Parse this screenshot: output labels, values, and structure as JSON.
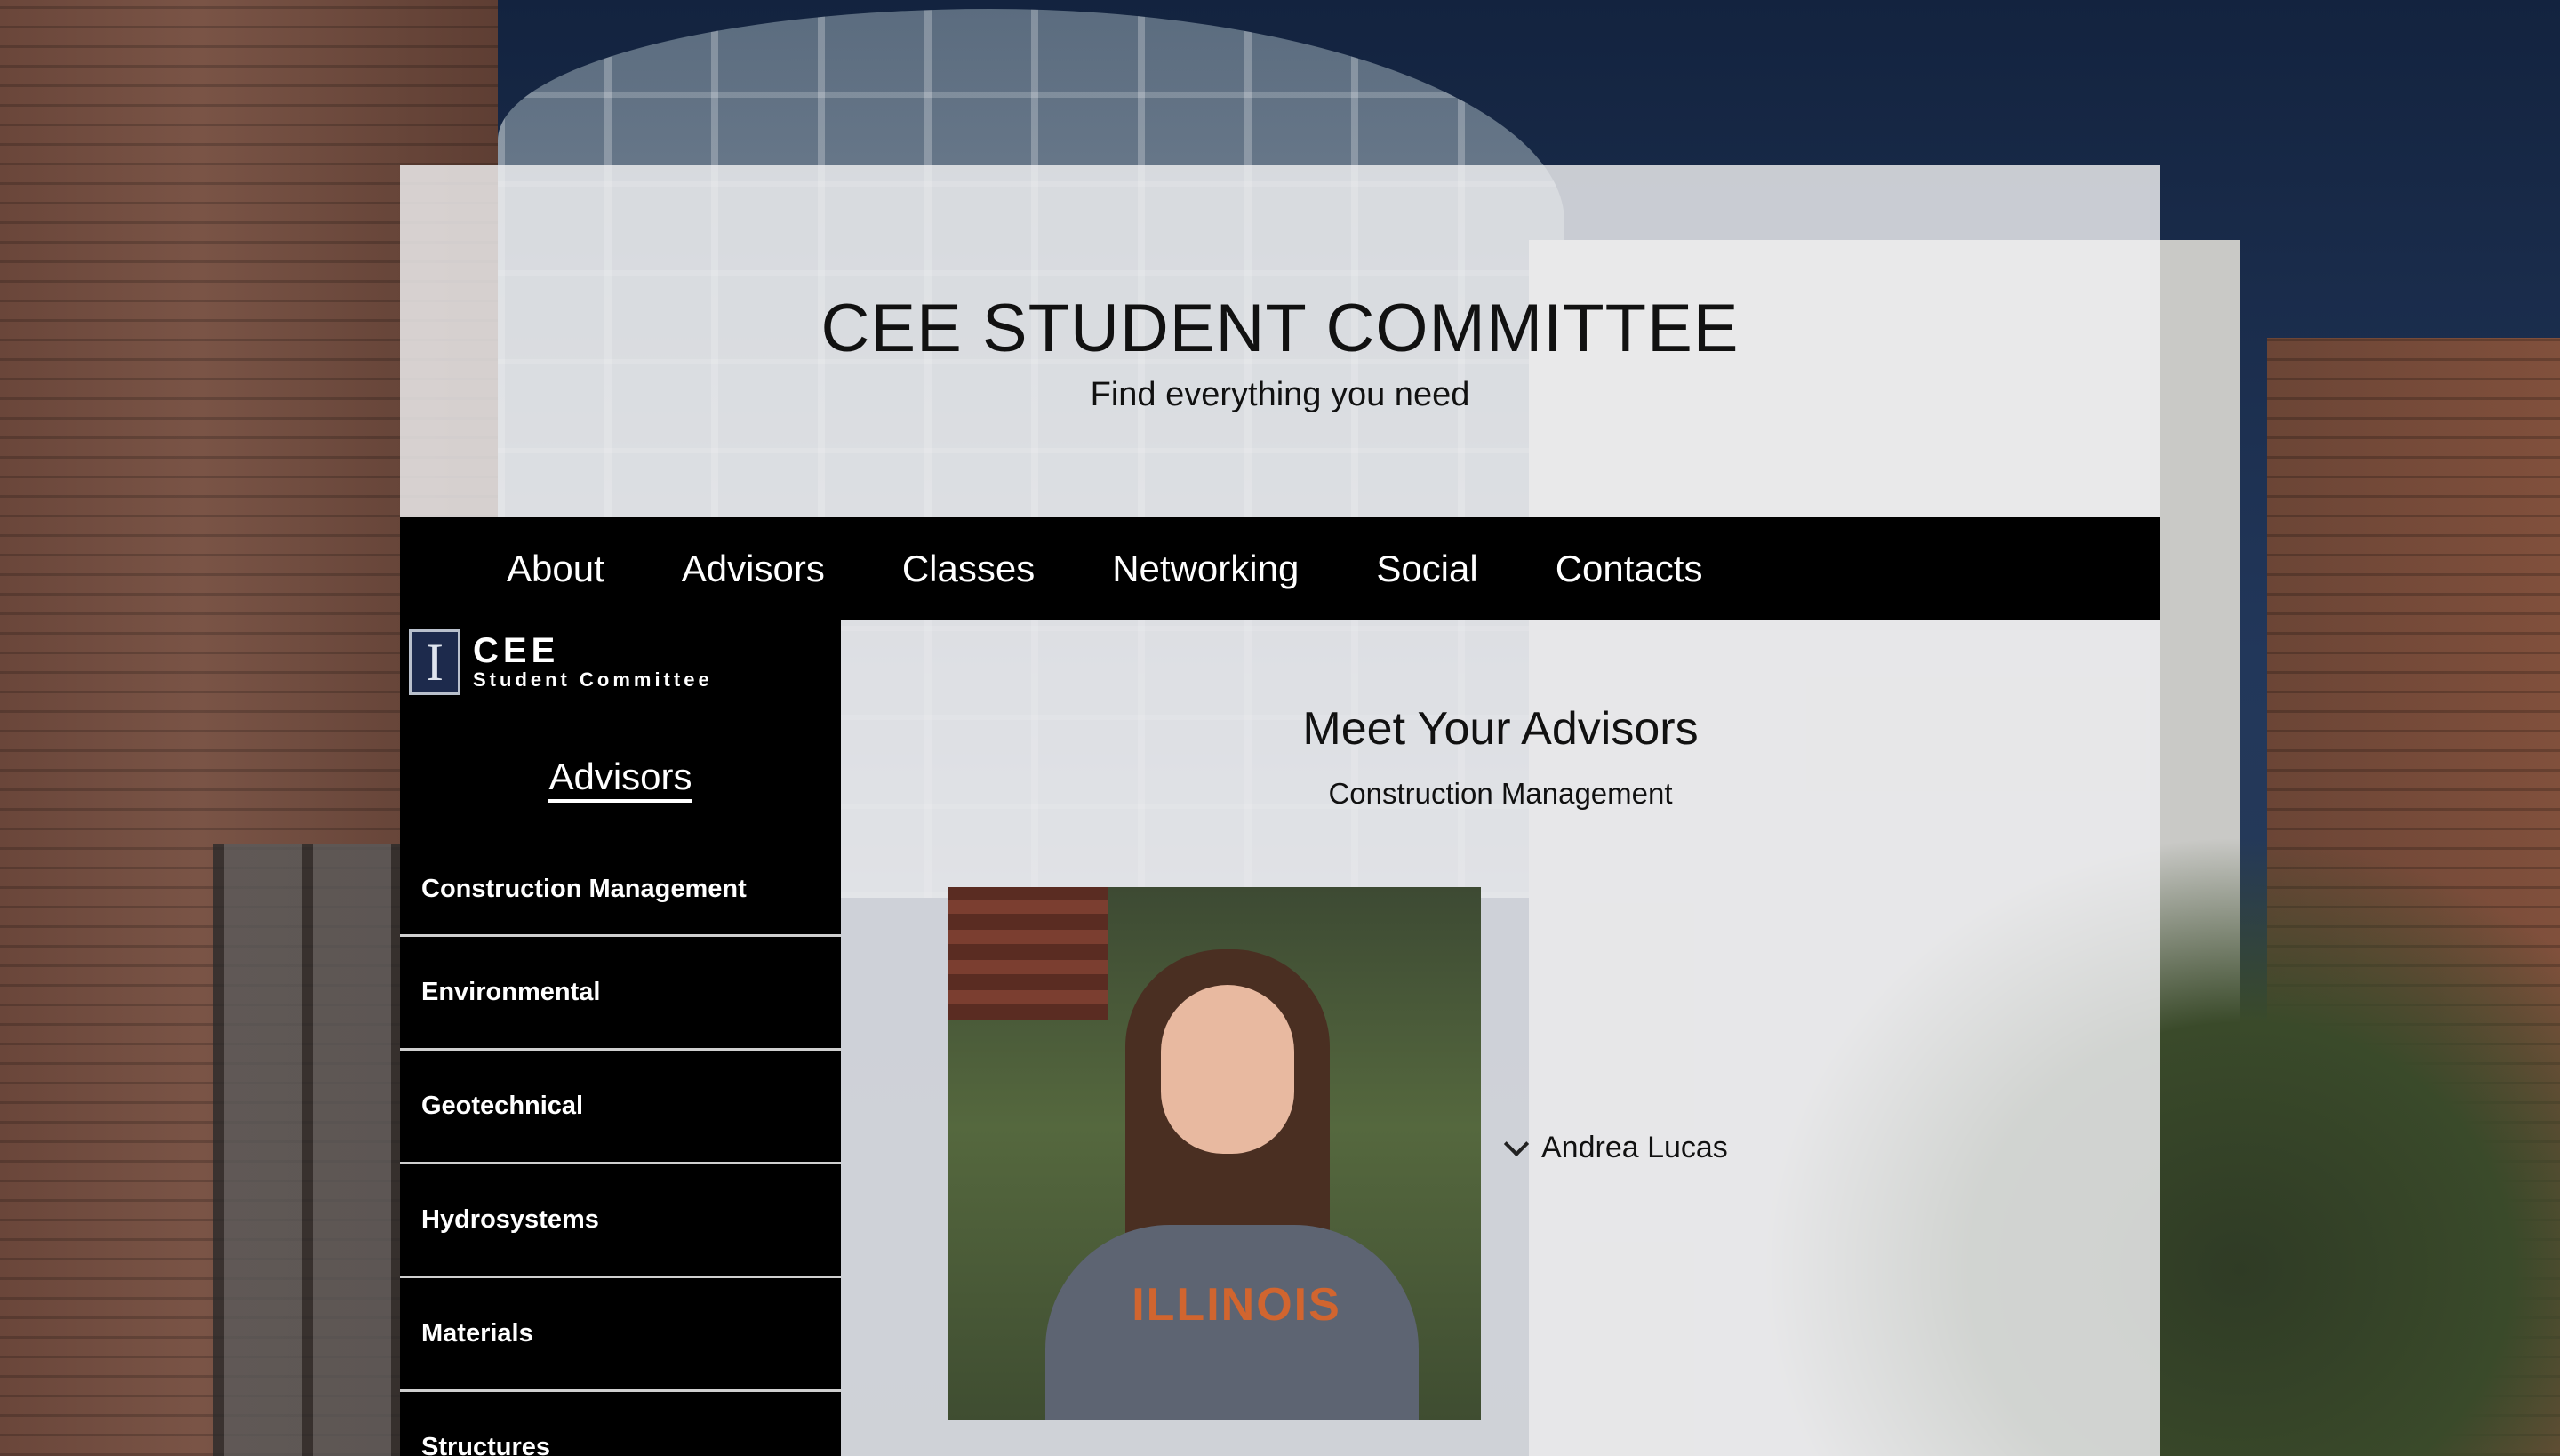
{
  "header": {
    "title": "CEE STUDENT COMMITTEE",
    "subtitle": "Find everything you need"
  },
  "nav": {
    "items": [
      "About",
      "Advisors",
      "Classes",
      "Networking",
      "Social",
      "Contacts"
    ]
  },
  "sidebar": {
    "logo": {
      "line1": "CEE",
      "line2": "Student Committee",
      "mark": "I"
    },
    "heading": "Advisors",
    "items": [
      "Construction Management",
      "Environmental",
      "Geotechnical",
      "Hydrosystems",
      "Materials",
      "Structures"
    ]
  },
  "main": {
    "title": "Meet Your Advisors",
    "subtitle": "Construction Management",
    "photo_shirt_text": "ILLINOIS",
    "advisor": {
      "name": "Andrea Lucas",
      "icon": "chevron-down-icon"
    }
  }
}
